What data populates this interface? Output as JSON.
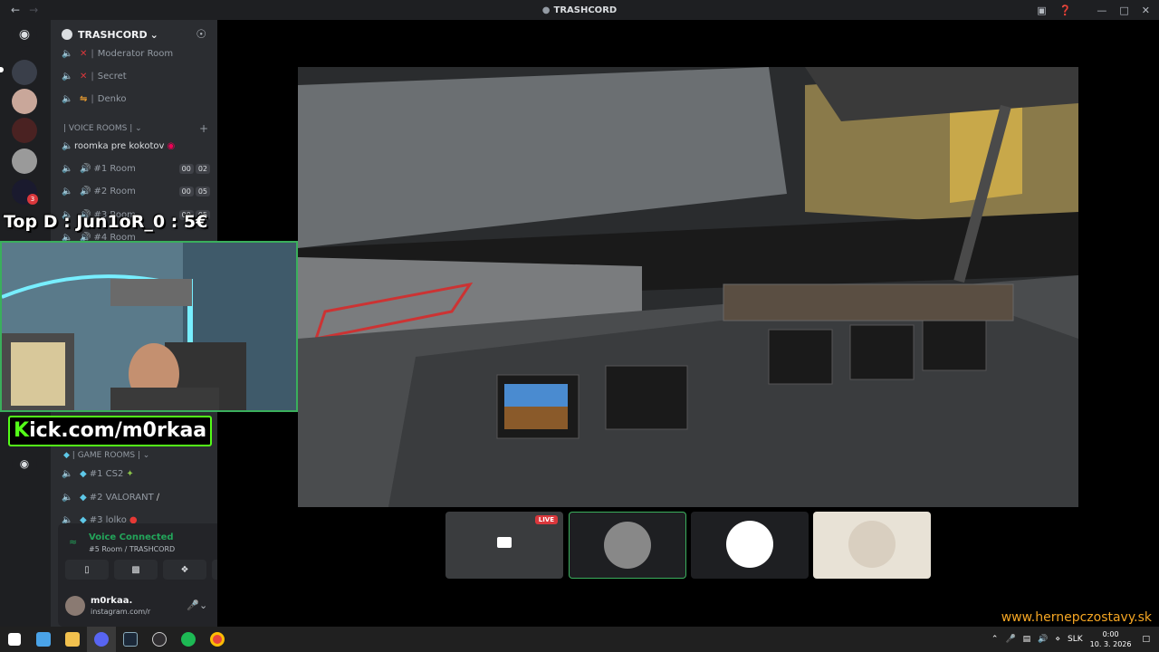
{
  "window": {
    "title": "TRASHCORD",
    "back_icon": "arrow-left-icon",
    "forward_icon": "arrow-right-icon"
  },
  "server": {
    "name": "TRASHCORD"
  },
  "channels": {
    "top": [
      {
        "label": "Moderator Room",
        "marker": "x"
      },
      {
        "label": "Secret",
        "marker": "x"
      },
      {
        "label": "Denko",
        "marker": "rss"
      }
    ],
    "voice_category": "VOICE ROOMS",
    "voice": [
      {
        "label": "roomka pre kokotov"
      },
      {
        "label": "#1 Room",
        "counts": [
          "00",
          "02"
        ]
      },
      {
        "label": "#2 Room",
        "counts": [
          "00",
          "05"
        ]
      },
      {
        "label": "#3 Room",
        "counts": [
          "00",
          "05"
        ]
      },
      {
        "label": "#4 Room"
      }
    ],
    "game_category": "GAME ROOMS",
    "game": [
      {
        "label": "#1 CS2"
      },
      {
        "label": "#2 VALORANT"
      },
      {
        "label": "#3 lolko"
      }
    ]
  },
  "voice_panel": {
    "status": "Voice Connected",
    "location": "#5 Room / TRASHCORD"
  },
  "user": {
    "name": "m0rkaa.",
    "status": "instagram.com/r"
  },
  "overlays": {
    "top_donor": "Top D : Jun1oR_0 : 5€",
    "kick_prefix": "K",
    "kick_rest": "ick.com/m0rkaa",
    "watermark": "www.hernepczostavy.sk"
  },
  "stage": {
    "live_badge": "LIVE"
  },
  "taskbar": {
    "language": "SLK",
    "time": "0:00",
    "date": "10. 3. 2026",
    "notification_badge": "3"
  },
  "colors": {
    "accent_green": "#23a55a",
    "live_red": "#da373c",
    "kick_green": "#53fc18",
    "watermark_orange": "#f5a623"
  }
}
